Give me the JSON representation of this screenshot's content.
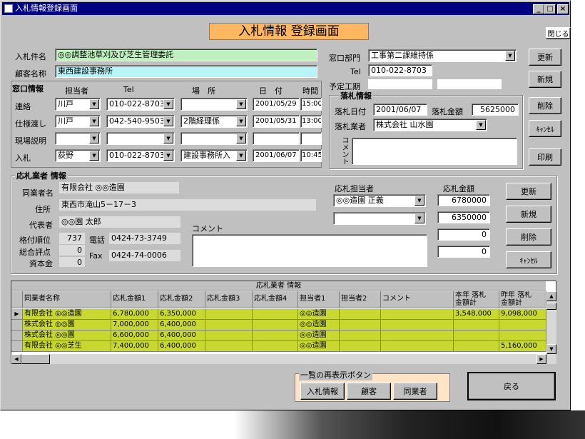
{
  "window": {
    "title": "入札情報登録画面",
    "min": "_",
    "max": "□",
    "close": "×"
  },
  "header": {
    "title": "入札情報 登録画面",
    "close_label": "閉じる"
  },
  "bid": {
    "name_label": "入札件名",
    "name": "◎◎調整池草刈及び芝生管理委託",
    "client_label": "顧客名称",
    "client": "東西建設事務所",
    "dept_label": "窓口部門",
    "dept": "工事第二課維持係",
    "tel_label": "Tel",
    "tel": "010-022-8703",
    "schedule_label": "予定工期"
  },
  "contact": {
    "section_label": "窓口情報",
    "headers": [
      "担当者",
      "Tel",
      "場　所",
      "日　付",
      "時間"
    ],
    "rows": [
      {
        "label": "連絡",
        "person": "川戸",
        "tel": "010-022-8703",
        "place": "",
        "date": "2001/05/29",
        "time": "15:00"
      },
      {
        "label": "仕様渡し",
        "person": "川戸",
        "tel": "042-540-9503",
        "place": "2階経理係",
        "date": "2001/05/31",
        "time": "13:00"
      },
      {
        "label": "現場説明",
        "person": "",
        "tel": "",
        "place": "",
        "date": "",
        "time": ""
      },
      {
        "label": "入札",
        "person": "荻野",
        "tel": "010-022-8703",
        "place": "建設事務所入",
        "date": "2001/06/07",
        "time": "10:45"
      }
    ]
  },
  "award": {
    "title": "落札情報",
    "date_label": "落札日付",
    "date": "2001/06/07",
    "amount_label": "落札金額",
    "amount": "5625000",
    "vendor_label": "落札業者",
    "vendor": "株式会社 山水園",
    "comment_label": "コメント"
  },
  "side_buttons": {
    "update": "更新",
    "new": "新規",
    "delete": "削除",
    "cancel": "ｷｬﾝｾﾙ",
    "print": "印刷"
  },
  "bidder": {
    "title": "応札業者 情報",
    "company_label": "同業者名",
    "company": "有限会社 ◎◎造園",
    "address_label": "住所",
    "address": "東西市滝山5－17－3",
    "rep_label": "代表者",
    "rep": "◎◎園 太郎",
    "rank_label": "格付順位",
    "rank": "737",
    "phone_label": "電話",
    "phone": "0424-73-3749",
    "score_label": "総合評点",
    "score": "0",
    "fax_label": "Fax",
    "fax": "0424-74-0006",
    "capital_label": "資本金",
    "capital": "0",
    "comment_label": "コメント",
    "staff_label": "応札担当者",
    "staff1": "◎◎造園 正義",
    "staff2": "",
    "amount_label": "応札金額",
    "amounts": [
      "6780000",
      "6350000",
      "0",
      "0"
    ],
    "buttons": {
      "update": "更新",
      "new": "新規",
      "delete": "削除",
      "cancel": "ｷｬﾝｾﾙ"
    }
  },
  "grid": {
    "caption": "応札業者 情報",
    "headers": [
      "同業者名称",
      "応札金額1",
      "応札金額2",
      "応札金額3",
      "応札金額4",
      "担当者1",
      "担当者2",
      "コメント",
      "本年 落札\n金額計",
      "昨年 落札\n金額計"
    ],
    "rows": [
      [
        "有限会社 ◎◎造園",
        "6,780,000",
        "6,350,000",
        "",
        "",
        "◎◎造園",
        "",
        "",
        "3,548,000",
        "9,098,000"
      ],
      [
        "株式会社 ◎◎園",
        "7,000,000",
        "6,400,000",
        "",
        "",
        "◎◎造園",
        "",
        "",
        "",
        ""
      ],
      [
        "株式会社 ◎◎園",
        "6,600,000",
        "6,400,000",
        "",
        "",
        "◎◎造園",
        "",
        "",
        "",
        ""
      ],
      [
        "有限会社 ◎◎芝生",
        "7,400,000",
        "6,400,000",
        "",
        "",
        "◎◎造園",
        "",
        "",
        "",
        "5,160,000"
      ]
    ]
  },
  "refresh": {
    "title": "一覧の再表示ボタン",
    "bid": "入札情報",
    "client": "顧客",
    "peer": "同業者"
  },
  "back_label": "戻る"
}
